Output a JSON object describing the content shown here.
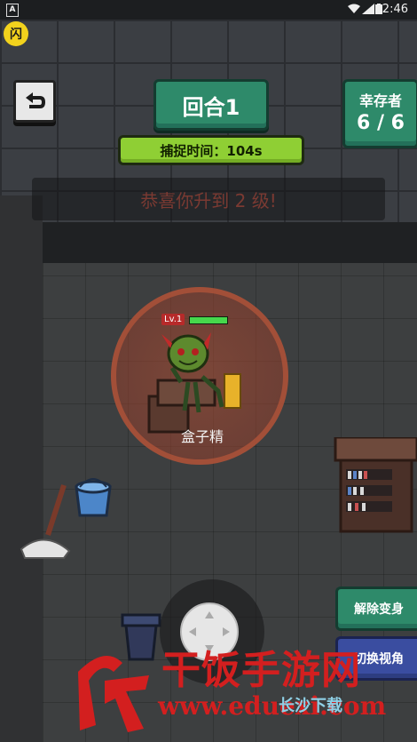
{
  "statusbar": {
    "app_badge": "A",
    "time": "2:46"
  },
  "overlay_badge": "闪",
  "hud": {
    "round_title": "回合1",
    "capture_timer": "捕捉时间：104s",
    "survivors_label": "幸存者",
    "survivors_value": "6 / 6"
  },
  "banner_text": "恭喜你升到 2 级!",
  "character": {
    "level_tag": "Lv.1",
    "name": "盒子精",
    "hp_fraction": 1.0
  },
  "buttons": {
    "cancel_transform": "解除变身",
    "switch_view": "切换视角"
  },
  "watermark": {
    "main_text": "干饭手游网",
    "url_text": "www.eduexi.com",
    "corner_text": "长沙下载"
  },
  "colors": {
    "hud_green": "#2e8a6a",
    "timer_green": "#8fcf34",
    "aura": "#b14e32",
    "watermark_red": "#d31f1f"
  }
}
